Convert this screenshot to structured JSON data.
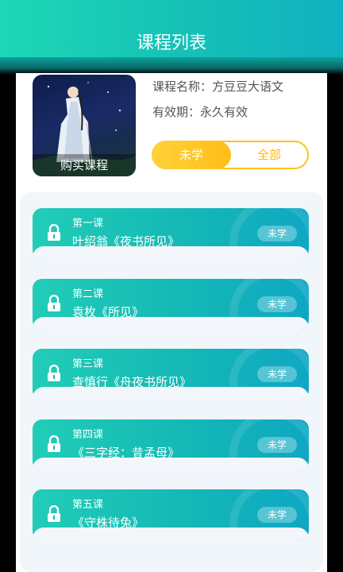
{
  "header": {
    "title": "课程列表"
  },
  "course": {
    "cover_button": "购买课程",
    "name_line": "课程名称：方豆豆大语文",
    "validity_line": "有效期：永久有效"
  },
  "filter": {
    "options": [
      "未学",
      "全部"
    ],
    "selected": "未学",
    "active_color": "#ffc21d"
  },
  "lessons": [
    {
      "number": "第一课",
      "title": "叶绍翁《夜书所见》",
      "status": "未学",
      "locked": true
    },
    {
      "number": "第二课",
      "title": "袁枚《所见》",
      "status": "未学",
      "locked": true
    },
    {
      "number": "第三课",
      "title": "查慎行《舟夜书所见》",
      "status": "未学",
      "locked": true
    },
    {
      "number": "第四课",
      "title": "《三字经：昔孟母》",
      "status": "未学",
      "locked": true
    },
    {
      "number": "第五课",
      "title": "《守株待兔》",
      "status": "未学",
      "locked": true
    }
  ],
  "colors": {
    "header_start": "#1dd7b6",
    "header_end": "#0fb1c0",
    "lesson_card": "#14b8b6"
  }
}
